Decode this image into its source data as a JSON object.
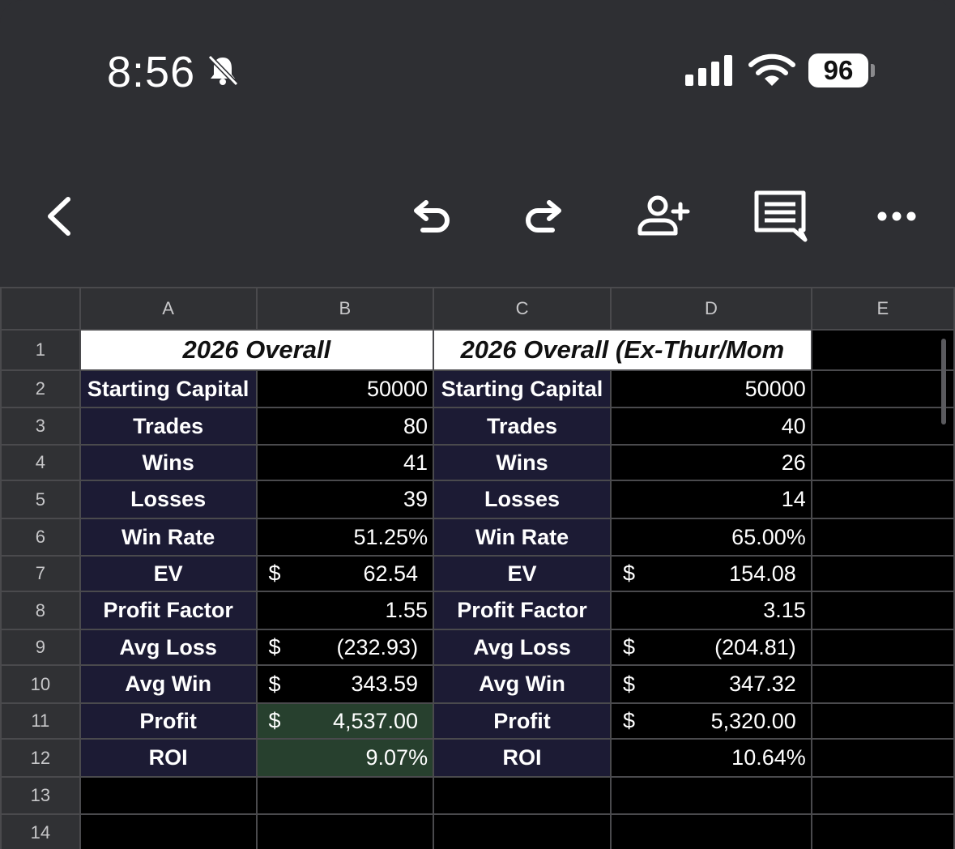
{
  "status_bar": {
    "time": "8:56",
    "battery": "96"
  },
  "columns": [
    "A",
    "B",
    "C",
    "D",
    "E"
  ],
  "rows": [
    "1",
    "2",
    "3",
    "4",
    "5",
    "6",
    "7",
    "8",
    "9",
    "10",
    "11",
    "12",
    "13",
    "14"
  ],
  "titles": {
    "left": "2026 Overall",
    "right": "2026 Overall (Ex-Thur/Mom"
  },
  "left_table": [
    {
      "label": "Starting Capital",
      "value": "50000",
      "currency": ""
    },
    {
      "label": "Trades",
      "value": "80",
      "currency": ""
    },
    {
      "label": "Wins",
      "value": "41",
      "currency": ""
    },
    {
      "label": "Losses",
      "value": "39",
      "currency": ""
    },
    {
      "label": "Win Rate",
      "value": "51.25%",
      "currency": ""
    },
    {
      "label": "EV",
      "value": "62.54",
      "currency": "$"
    },
    {
      "label": "Profit Factor",
      "value": "1.55",
      "currency": ""
    },
    {
      "label": "Avg Loss",
      "value": "(232.93)",
      "currency": "$"
    },
    {
      "label": "Avg Win",
      "value": "343.59",
      "currency": "$"
    },
    {
      "label": "Profit",
      "value": "4,537.00",
      "currency": "$"
    },
    {
      "label": "ROI",
      "value": "9.07%",
      "currency": ""
    }
  ],
  "right_table": [
    {
      "label": "Starting Capital",
      "value": "50000",
      "currency": ""
    },
    {
      "label": "Trades",
      "value": "40",
      "currency": ""
    },
    {
      "label": "Wins",
      "value": "26",
      "currency": ""
    },
    {
      "label": "Losses",
      "value": "14",
      "currency": ""
    },
    {
      "label": "Win Rate",
      "value": "65.00%",
      "currency": ""
    },
    {
      "label": "EV",
      "value": "154.08",
      "currency": "$"
    },
    {
      "label": "Profit Factor",
      "value": "3.15",
      "currency": ""
    },
    {
      "label": "Avg Loss",
      "value": "(204.81)",
      "currency": "$"
    },
    {
      "label": "Avg Win",
      "value": "347.32",
      "currency": "$"
    },
    {
      "label": "Profit",
      "value": "5,320.00",
      "currency": "$"
    },
    {
      "label": "ROI",
      "value": "10.64%",
      "currency": ""
    }
  ],
  "colors": {
    "label_bg": "#1c1b34",
    "highlight_bg": "#27402e",
    "toolbar_bg": "#2e2f33"
  },
  "icons": [
    "back-icon",
    "undo-icon",
    "redo-icon",
    "add-person-icon",
    "comment-icon",
    "more-icon"
  ]
}
